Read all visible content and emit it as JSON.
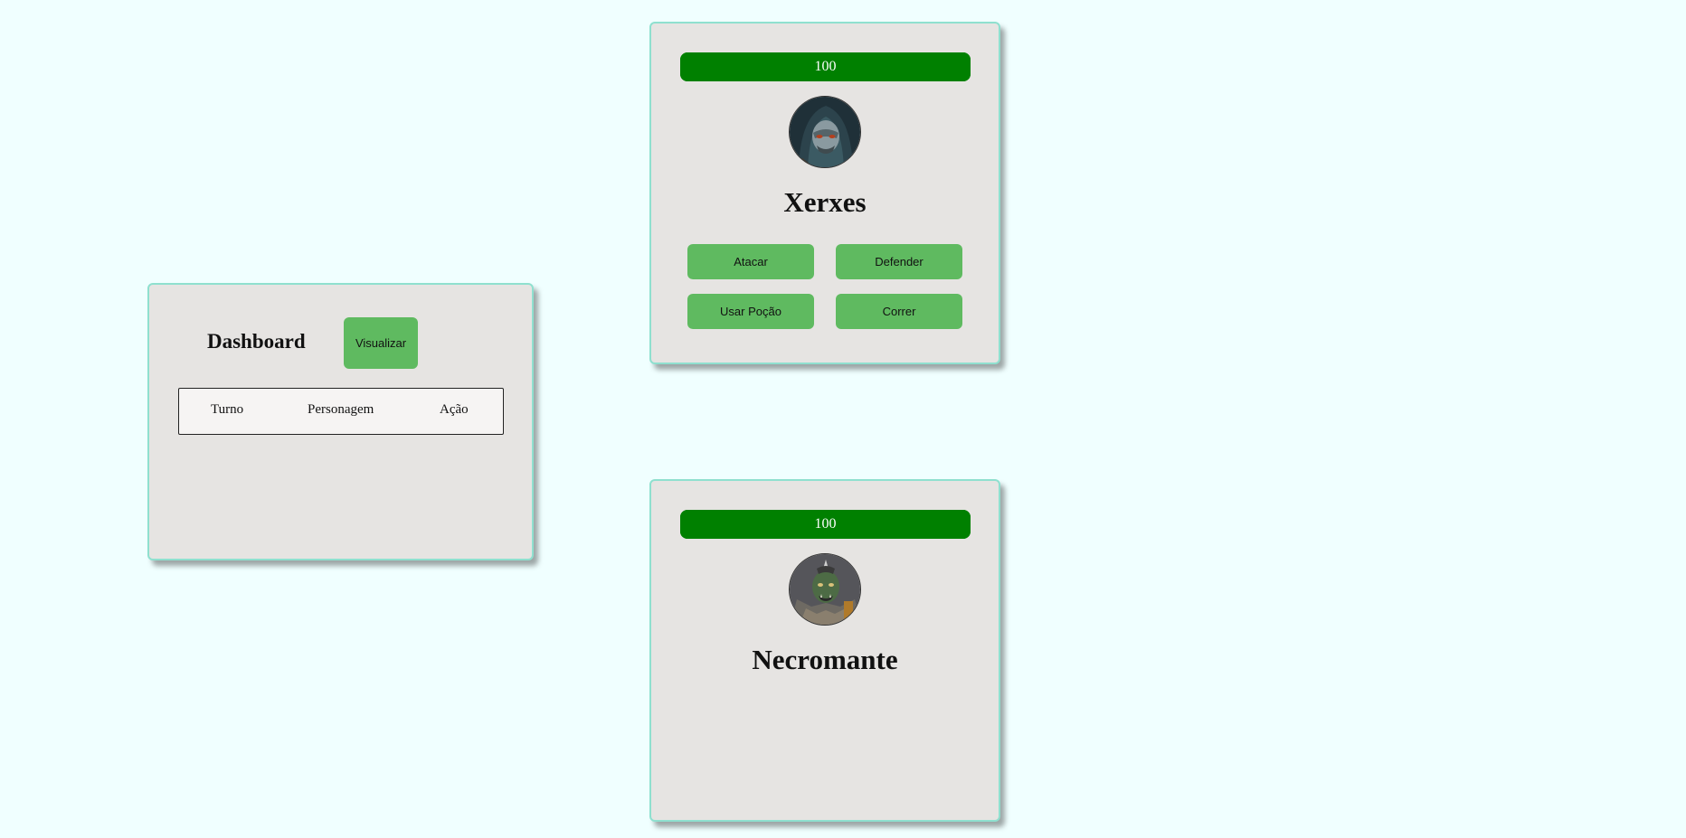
{
  "dashboard": {
    "title": "Dashboard",
    "view_button": "Visualizar",
    "table_headers": [
      "Turno",
      "Personagem",
      "Ação"
    ]
  },
  "player": {
    "hp_value": 100,
    "hp_label": "100",
    "hp_bar_color": "#008000",
    "avatar_icon": "hooded-masked-warrior-portrait",
    "name": "Xerxes",
    "actions": [
      "Atacar",
      "Defender",
      "Usar Poção",
      "Correr"
    ]
  },
  "enemy": {
    "hp_value": 100,
    "hp_label": "100",
    "hp_bar_color": "#008000",
    "avatar_icon": "armored-orc-portrait",
    "name": "Necromante"
  },
  "colors": {
    "page_background": "#f0ffff",
    "card_background": "#e6e4e2",
    "card_border": "#8fe0cf",
    "button_green": "#5fba60"
  }
}
